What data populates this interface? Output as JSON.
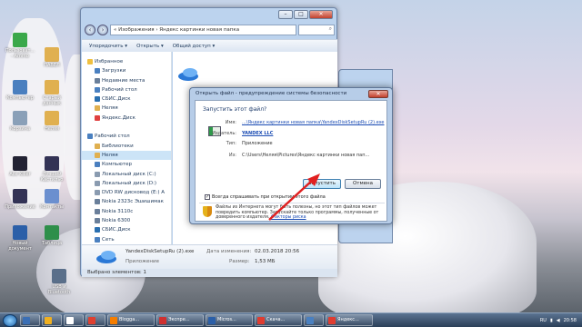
{
  "desktop_icons": [
    {
      "label": "Пользоват... - Ammo",
      "color": "#3aa84a"
    },
    {
      "label": "Компьютер",
      "color": "#4a7fbf"
    },
    {
      "label": "Корзина",
      "color": "#8aa0b8"
    },
    {
      "label": "ПАВЕЛ",
      "color": "#e0b050"
    },
    {
      "label": "Старый даннык",
      "color": "#e0b050"
    },
    {
      "label": "Неляя",
      "color": "#e0b050"
    },
    {
      "label": "Ace Killer",
      "color": "#223"
    },
    {
      "label": "Приложение",
      "color": "#335"
    },
    {
      "label": "Лучший Кастильо",
      "color": "#335"
    },
    {
      "label": "Контакты",
      "color": "#6b8fcf"
    },
    {
      "label": "Новый документ",
      "color": "#2b5fa8"
    },
    {
      "label": "Таблица",
      "color": "#2e8f4a"
    },
    {
      "label": "USB и Bluetooth",
      "color": "#5a6f8a"
    }
  ],
  "explorer": {
    "path": "« Изображения › Яндекс картинки новая папка",
    "search_placeholder": "Поиск",
    "toolbar": {
      "organize": "Упорядочить ▾",
      "open": "Открыть ▾",
      "share": "Общий доступ ▾"
    },
    "sidebar": [
      {
        "label": "Избранное",
        "level": 1,
        "color": "#f0c040"
      },
      {
        "label": "Загрузки",
        "level": 2,
        "color": "#4a80c0"
      },
      {
        "label": "Недавние места",
        "level": 2,
        "color": "#6a7f9a"
      },
      {
        "label": "Рабочий стол",
        "level": 2,
        "color": "#4a80c0"
      },
      {
        "label": "СБИС.Диск",
        "level": 2,
        "color": "#2a6fb0"
      },
      {
        "label": "Неляя",
        "level": 2,
        "color": "#e0b050"
      },
      {
        "label": "Яндекс.Диск",
        "level": 2,
        "color": "#e04040"
      },
      {
        "label": "",
        "level": 0,
        "color": ""
      },
      {
        "label": "Рабочий стол",
        "level": 1,
        "color": "#4a80c0"
      },
      {
        "label": "Библиотеки",
        "level": 2,
        "color": "#e0b050"
      },
      {
        "label": "Неляя",
        "level": 2,
        "color": "#e0b050",
        "selected": true
      },
      {
        "label": "Компьютер",
        "level": 2,
        "color": "#4a7fbf"
      },
      {
        "label": "Локальный диск (C:)",
        "level": 2,
        "color": "#8a9bb0"
      },
      {
        "label": "Локальный диск (D:)",
        "level": 2,
        "color": "#8a9bb0"
      },
      {
        "label": "DVD RW дисковод (E:) A",
        "level": 2,
        "color": "#8a9bb0"
      },
      {
        "label": "Nokia 2323c Эшишимак",
        "level": 2,
        "color": "#6a7f9a"
      },
      {
        "label": "Nokia 3110c",
        "level": 2,
        "color": "#6a7f9a"
      },
      {
        "label": "Nokia 6300",
        "level": 2,
        "color": "#6a7f9a"
      },
      {
        "label": "СБИС.Диск",
        "level": 2,
        "color": "#2a6fb0"
      },
      {
        "label": "Сеть",
        "level": 2,
        "color": "#4a80c0"
      }
    ],
    "file": {
      "name": "YandexDiskSetupRu (2).exe",
      "modified_label": "Дата изменения:",
      "modified": "02.03.2018 20:56",
      "type": "Приложение",
      "size_label": "Размер:",
      "size": "1,53 МБ"
    },
    "status": "Выбрано элементов: 1"
  },
  "dialog": {
    "title": "Открыть файл - предупреждение системы безопасности",
    "question": "Запустить этот файл?",
    "name_label": "Имя:",
    "name_value": "...\\Яндекс картинки новая папка\\YandexDiskSetupRu (2).exe",
    "publisher_label": "Издатель:",
    "publisher_value": "YANDEX LLC",
    "type_label": "Тип:",
    "type_value": "Приложение",
    "from_label": "Из:",
    "from_value": "C:\\Users\\Неляя\\Pictures\\Яндекс картинки новая пап...",
    "run_button": "Запустить",
    "cancel_button": "Отмена",
    "always_ask": "Всегда спрашивать при открытии этого файла",
    "warning": "Файлы из Интернета могут быть полезны, но этот тип файлов может повредить компьютер. Запускайте только программы, полученные от доверенного издателя.",
    "risk_link": "Факторы риска"
  },
  "taskbar": {
    "items": [
      {
        "label": "",
        "color": "#3b6fb5"
      },
      {
        "label": "",
        "color": "#f0b020"
      },
      {
        "label": "",
        "color": "#ffffff"
      },
      {
        "label": "",
        "color": "#e04030"
      },
      {
        "label": "Blogga...",
        "color": "#f57d00"
      },
      {
        "label": "Экспре...",
        "color": "#d03030"
      },
      {
        "label": "Micros...",
        "color": "#2b5fa8"
      },
      {
        "label": "Скача...",
        "color": "#e03c30"
      },
      {
        "label": "",
        "color": "#4a80c0"
      },
      {
        "label": "Яндекс...",
        "color": "#e03c30"
      }
    ],
    "lang": "RU",
    "time": "20:58"
  }
}
